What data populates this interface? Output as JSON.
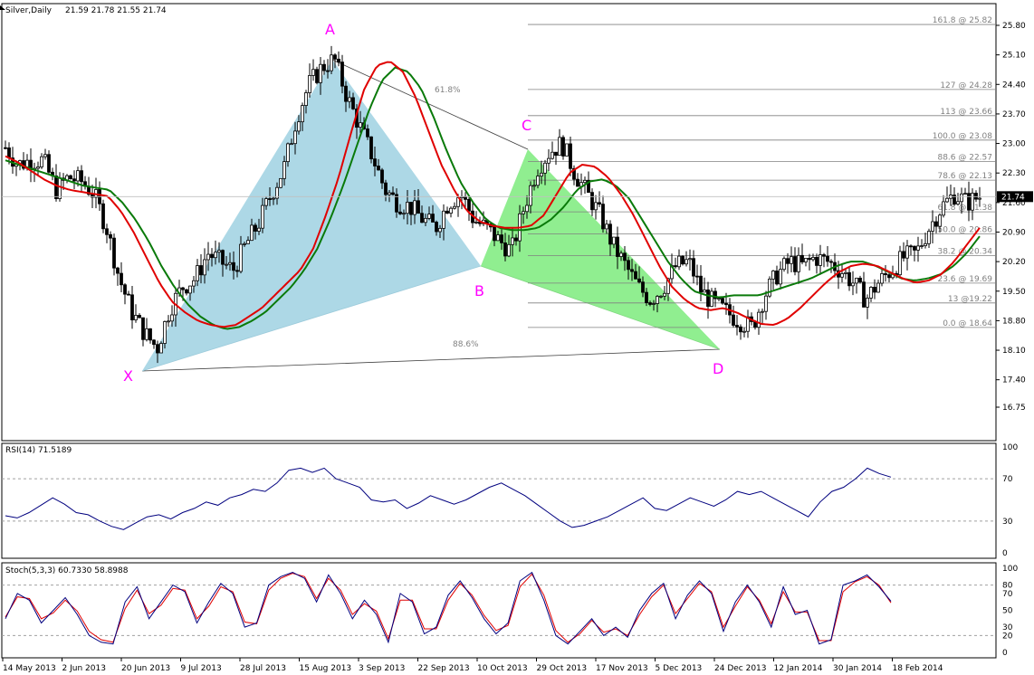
{
  "header": {
    "symbol": "Silver,Daily",
    "ohlc": "21.59 21.78 21.55 21.74"
  },
  "colors": {
    "candle": "#000000",
    "ma_fast": "#e00000",
    "ma_slow": "#0a7a0a",
    "ma_flat": "#f0e000",
    "pattern_xab": "#add8e6",
    "pattern_bcd": "#90ee90",
    "pattern_letters": "#ff00ff",
    "fib_line": "#808080",
    "fib_text": "#808080",
    "rsi": "#00007f",
    "stoch_main": "#00007f",
    "stoch_signal": "#e00000"
  },
  "chart_data": [
    {
      "type": "candlestick",
      "panel": "price",
      "x_ticks": [
        "14 May 2013",
        "2 Jun 2013",
        "20 Jun 2013",
        "9 Jul 2013",
        "28 Jul 2013",
        "15 Aug 2013",
        "3 Sep 2013",
        "22 Sep 2013",
        "10 Oct 2013",
        "29 Oct 2013",
        "17 Nov 2013",
        "5 Dec 2013",
        "24 Dec 2013",
        "12 Jan 2014",
        "30 Jan 2014",
        "18 Feb 2014"
      ],
      "y_ticks": [
        "25.80",
        "25.10",
        "24.40",
        "23.70",
        "23.00",
        "22.30",
        "21.60",
        "20.90",
        "20.20",
        "19.50",
        "18.80",
        "18.10",
        "17.40",
        "16.75"
      ],
      "ylim": [
        16.75,
        25.8
      ],
      "current_price": "21.74",
      "price_path": [
        22.9,
        22.5,
        22.6,
        22.6,
        21.9,
        22.2,
        22.1,
        21.8,
        21.0,
        19.8,
        19.0,
        18.5,
        18.15,
        19.1,
        19.6,
        19.8,
        20.4,
        20.2,
        20.0,
        20.6,
        21.1,
        21.8,
        22.4,
        23.6,
        24.4,
        24.8,
        25.0,
        24.1,
        23.4,
        22.7,
        21.9,
        21.6,
        21.5,
        21.2,
        21.0,
        21.6,
        21.8,
        21.2,
        21.0,
        20.7,
        20.45,
        21.5,
        22.4,
        22.8,
        23.0,
        22.3,
        21.8,
        21.3,
        20.6,
        20.1,
        19.6,
        19.3,
        19.6,
        20.1,
        20.2,
        19.5,
        19.2,
        19.0,
        18.8,
        18.64,
        19.4,
        19.9,
        20.2,
        20.1,
        20.3,
        20.2,
        20.0,
        19.7,
        19.3,
        19.7,
        20.0,
        20.3,
        20.4,
        21.0,
        21.5,
        21.8,
        21.6,
        21.74
      ],
      "ma_fast_path": [
        22.7,
        22.55,
        22.35,
        22.15,
        22.0,
        21.9,
        21.85,
        21.8,
        21.75,
        21.4,
        20.9,
        20.3,
        19.7,
        19.25,
        19.0,
        18.8,
        18.7,
        18.65,
        18.7,
        18.9,
        19.1,
        19.4,
        19.7,
        20.0,
        20.5,
        21.3,
        22.2,
        23.3,
        24.3,
        24.85,
        24.95,
        24.7,
        24.1,
        23.3,
        22.5,
        21.9,
        21.4,
        21.15,
        21.05,
        21.0,
        21.0,
        21.05,
        21.3,
        21.8,
        22.3,
        22.5,
        22.45,
        22.2,
        21.8,
        21.3,
        20.7,
        20.1,
        19.6,
        19.3,
        19.1,
        19.05,
        19.1,
        19.0,
        18.85,
        18.72,
        18.7,
        18.85,
        19.1,
        19.4,
        19.7,
        19.95,
        20.1,
        20.15,
        20.1,
        19.95,
        19.8,
        19.7,
        19.75,
        19.9,
        20.2,
        20.6,
        21.0
      ],
      "ma_slow_path": [
        22.6,
        22.5,
        22.4,
        22.3,
        22.2,
        22.1,
        22.0,
        21.95,
        21.9,
        21.6,
        21.2,
        20.7,
        20.1,
        19.6,
        19.2,
        18.9,
        18.7,
        18.6,
        18.65,
        18.8,
        19.0,
        19.3,
        19.6,
        20.0,
        20.5,
        21.2,
        22.0,
        22.9,
        23.8,
        24.5,
        24.8,
        24.7,
        24.3,
        23.6,
        22.8,
        22.1,
        21.6,
        21.2,
        21.0,
        20.95,
        20.95,
        21.0,
        21.2,
        21.5,
        21.9,
        22.1,
        22.15,
        22.0,
        21.7,
        21.2,
        20.7,
        20.2,
        19.8,
        19.5,
        19.4,
        19.35,
        19.4,
        19.4,
        19.4,
        19.5,
        19.6,
        19.7,
        19.8,
        19.95,
        20.1,
        20.2,
        20.2,
        20.1,
        19.95,
        19.8,
        19.75,
        19.8,
        19.9,
        20.1,
        20.4,
        20.8
      ],
      "fib_levels": [
        {
          "label": "161.8 @ 25.82",
          "value": 25.82
        },
        {
          "label": "127 @ 24.28",
          "value": 24.28
        },
        {
          "label": "113 @ 23.66",
          "value": 23.66
        },
        {
          "label": "100.0 @ 23.08",
          "value": 23.08
        },
        {
          "label": "88.6 @ 22.57",
          "value": 22.57
        },
        {
          "label": "78.6 @ 22.13",
          "value": 22.13
        },
        {
          "label": "61.8 @ 21.38",
          "value": 21.38
        },
        {
          "label": "50.0 @ 20.86",
          "value": 20.86
        },
        {
          "label": "38.2 @ 20.34",
          "value": 20.34
        },
        {
          "label": "23.6 @ 19.69",
          "value": 19.69
        },
        {
          "label": "13 @19.22",
          "value": 19.22
        },
        {
          "label": "0.0 @ 18.64",
          "value": 18.64
        }
      ],
      "harmonic_pattern": {
        "points": [
          {
            "label": "X",
            "date": "24 Jun 2013",
            "price": 18.15
          },
          {
            "label": "A",
            "date": "27 Aug 2013",
            "price": 25.0
          },
          {
            "label": "B",
            "date": "15 Oct 2013",
            "price": 20.45
          },
          {
            "label": "C",
            "date": "30 Oct 2013",
            "price": 23.0
          },
          {
            "label": "D",
            "date": "31 Dec 2013",
            "price": 18.64
          }
        ],
        "ratios": [
          {
            "label": "61.8%",
            "between": [
              "A",
              "C"
            ]
          },
          {
            "label": "88.6%",
            "between": [
              "X",
              "D"
            ]
          }
        ]
      }
    },
    {
      "type": "line",
      "panel": "rsi",
      "title": "RSI(14) 71.5189",
      "ylim": [
        0,
        100
      ],
      "y_ticks": [
        "100",
        "70",
        "30",
        "0"
      ],
      "levels": [
        70,
        30
      ],
      "values": [
        35,
        33,
        38,
        45,
        52,
        46,
        38,
        36,
        30,
        25,
        22,
        28,
        34,
        36,
        32,
        38,
        42,
        48,
        45,
        52,
        55,
        60,
        58,
        66,
        78,
        80,
        76,
        80,
        70,
        66,
        62,
        50,
        48,
        50,
        42,
        47,
        54,
        50,
        46,
        50,
        56,
        62,
        66,
        60,
        54,
        46,
        38,
        30,
        24,
        26,
        30,
        34,
        40,
        46,
        52,
        42,
        40,
        46,
        52,
        48,
        44,
        50,
        58,
        55,
        58,
        52,
        46,
        40,
        34,
        48,
        58,
        62,
        70,
        80,
        75,
        71.5
      ]
    },
    {
      "type": "line",
      "panel": "stochastic",
      "title": "Stoch(5,3,3) 60.7330 58.8988",
      "ylim": [
        0,
        100
      ],
      "y_ticks": [
        "100",
        "80",
        "70",
        "50",
        "30",
        "20",
        "0"
      ],
      "levels": [
        80,
        20
      ],
      "main": [
        40,
        70,
        62,
        35,
        50,
        65,
        45,
        20,
        12,
        10,
        60,
        78,
        40,
        60,
        80,
        72,
        35,
        60,
        82,
        70,
        30,
        35,
        80,
        90,
        95,
        88,
        60,
        92,
        70,
        40,
        62,
        45,
        12,
        70,
        60,
        22,
        30,
        68,
        85,
        65,
        40,
        22,
        35,
        85,
        95,
        62,
        20,
        10,
        25,
        40,
        20,
        30,
        18,
        50,
        70,
        82,
        40,
        68,
        85,
        70,
        25,
        60,
        80,
        60,
        30,
        78,
        45,
        50,
        10,
        15,
        80,
        85,
        92,
        78,
        60.7
      ],
      "signal": [
        42,
        66,
        64,
        40,
        47,
        62,
        49,
        25,
        15,
        12,
        52,
        74,
        46,
        56,
        76,
        74,
        40,
        55,
        78,
        72,
        36,
        34,
        74,
        88,
        94,
        90,
        64,
        88,
        74,
        45,
        58,
        49,
        16,
        62,
        62,
        28,
        28,
        62,
        82,
        68,
        44,
        26,
        32,
        78,
        93,
        68,
        26,
        12,
        22,
        38,
        24,
        28,
        20,
        45,
        66,
        80,
        46,
        64,
        82,
        72,
        30,
        55,
        78,
        62,
        34,
        72,
        48,
        48,
        14,
        14,
        72,
        84,
        90,
        80,
        58.9
      ]
    }
  ]
}
